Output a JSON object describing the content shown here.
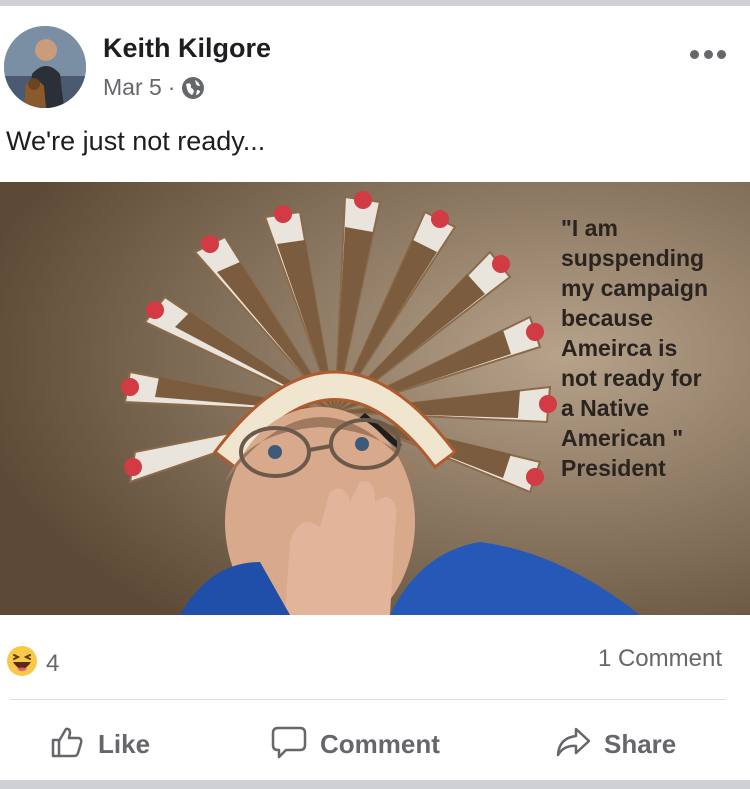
{
  "post": {
    "author": "Keith Kilgore",
    "date": "Mar 5",
    "separator": "·",
    "privacy_icon": "globe-icon",
    "text": "We're just not ready...",
    "more_icon": "more-options-icon"
  },
  "image": {
    "quote": "\"I am\nsupspending\nmy campaign\nbecause\nAmeirca is\nnot ready for\na Native\nAmerican \"\nPresident"
  },
  "stats": {
    "reaction_icon": "haha-reaction-icon",
    "reaction_count": "4",
    "comment_count": "1 Comment"
  },
  "actions": {
    "like_label": "Like",
    "comment_label": "Comment",
    "share_label": "Share"
  },
  "colors": {
    "secondary_text": "#65676b",
    "primary_text": "#1c1e21",
    "haha_yellow": "#f7c948"
  }
}
